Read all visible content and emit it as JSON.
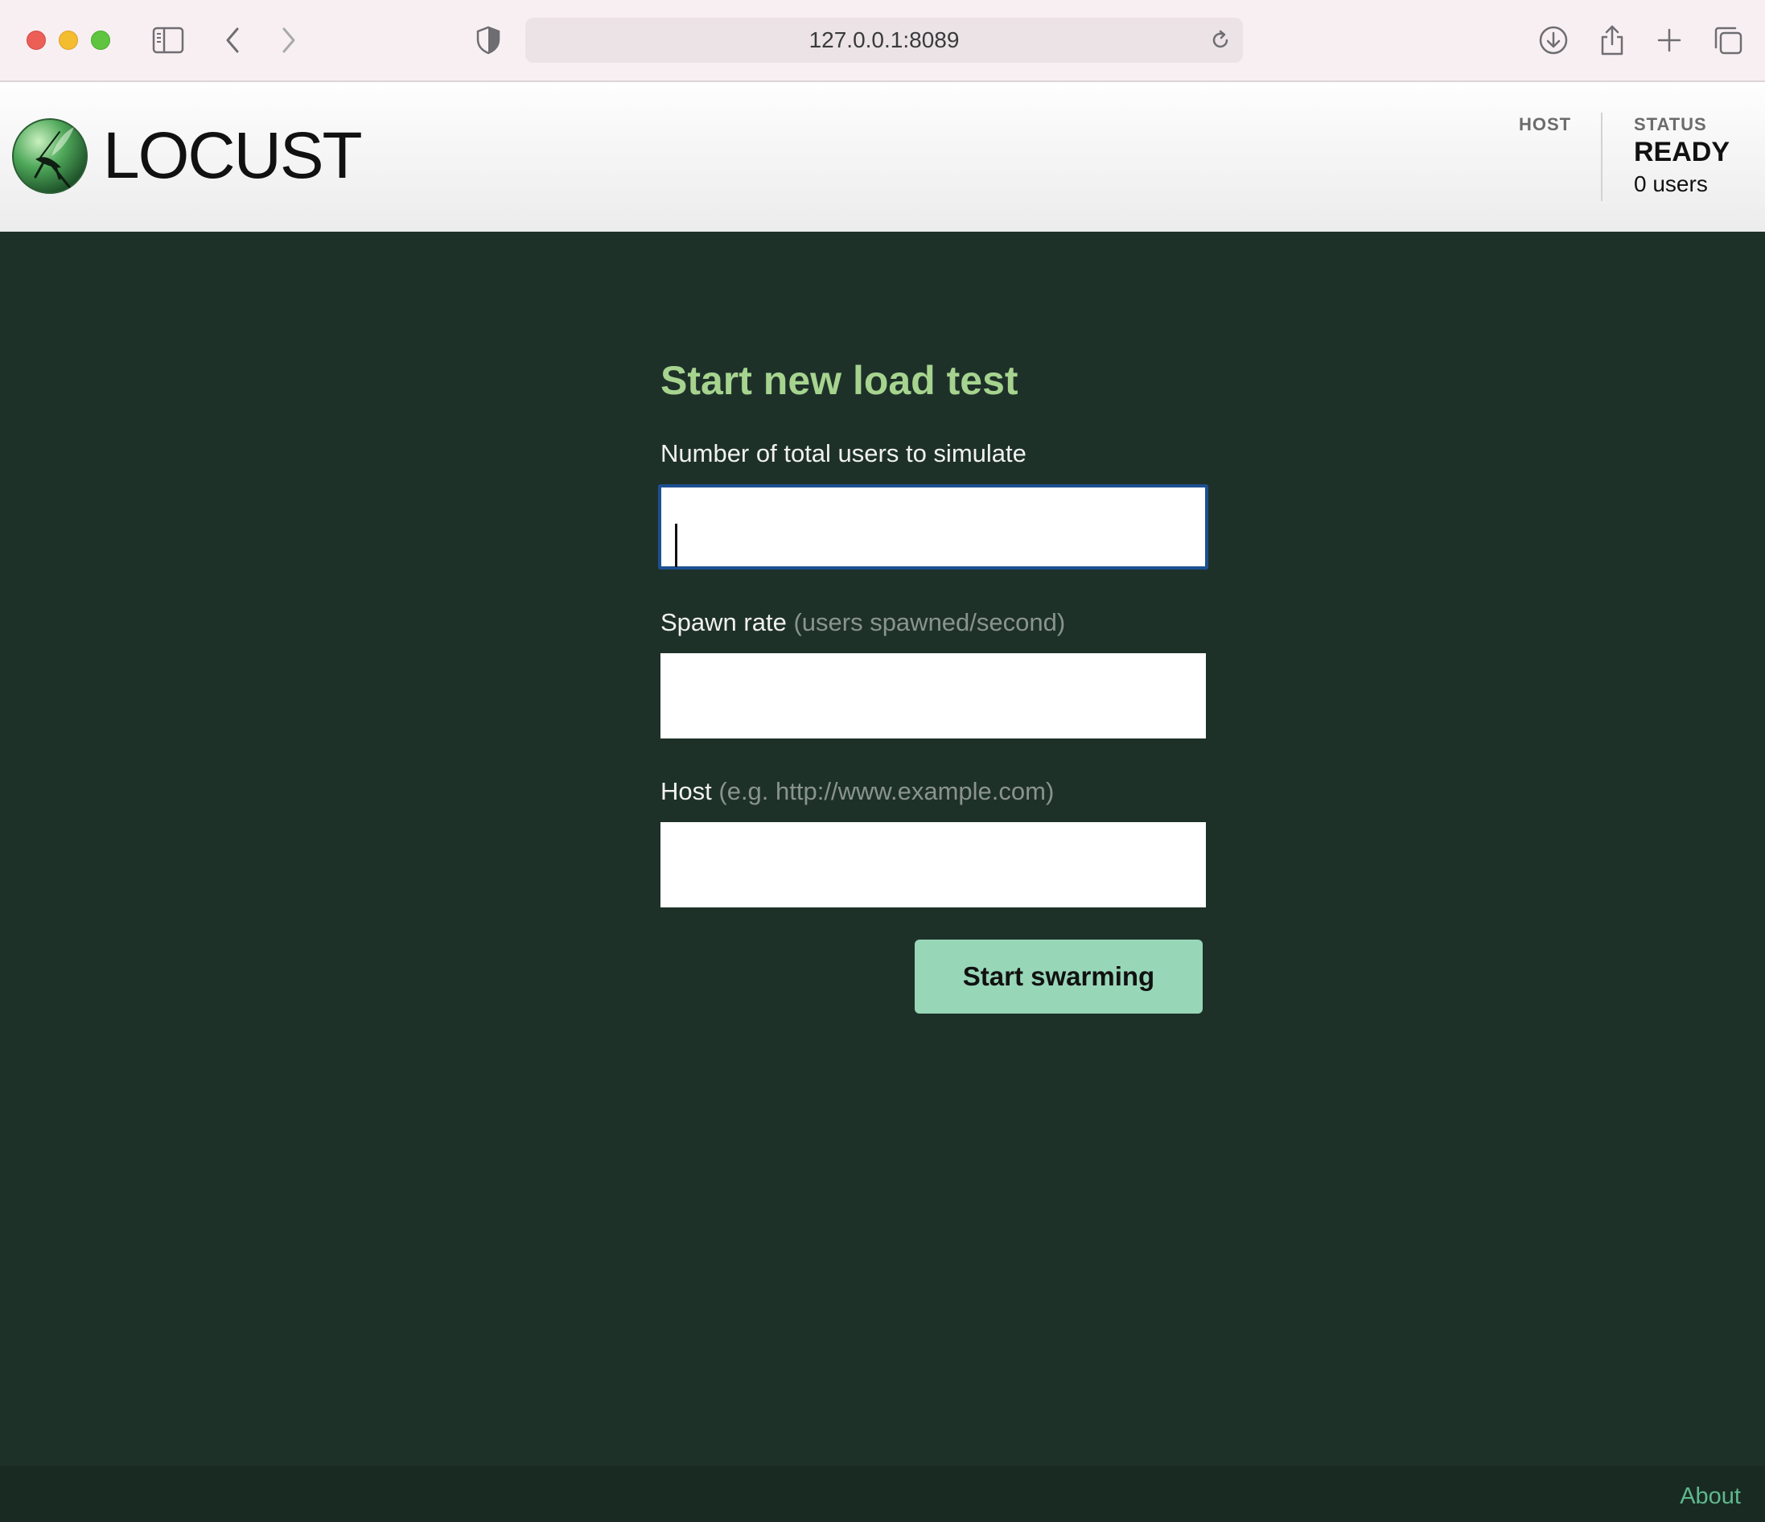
{
  "browser": {
    "url": "127.0.0.1:8089",
    "icons": [
      "sidebar-icon",
      "back-icon",
      "forward-icon",
      "privacy-shield-icon",
      "reload-icon",
      "download-icon",
      "share-icon",
      "new-tab-icon",
      "tab-overview-icon"
    ]
  },
  "header": {
    "logo_text": "LOCUST",
    "host_label": "HOST",
    "status_label": "STATUS",
    "status_value": "READY",
    "users_text": "0 users"
  },
  "form": {
    "title": "Start new load test",
    "users_label": "Number of total users to simulate",
    "users_value": "",
    "spawn_label": "Spawn rate",
    "spawn_hint": "(users spawned/second)",
    "spawn_value": "",
    "host_label": "Host",
    "host_hint": "(e.g. http://www.example.com)",
    "host_value": "",
    "submit_label": "Start swarming"
  },
  "footer": {
    "about_label": "About"
  },
  "colors": {
    "background": "#1e3129",
    "title": "#a6d48f",
    "button": "#98d6b8",
    "focus_border": "#1d4f91",
    "link": "#5fb88e"
  }
}
